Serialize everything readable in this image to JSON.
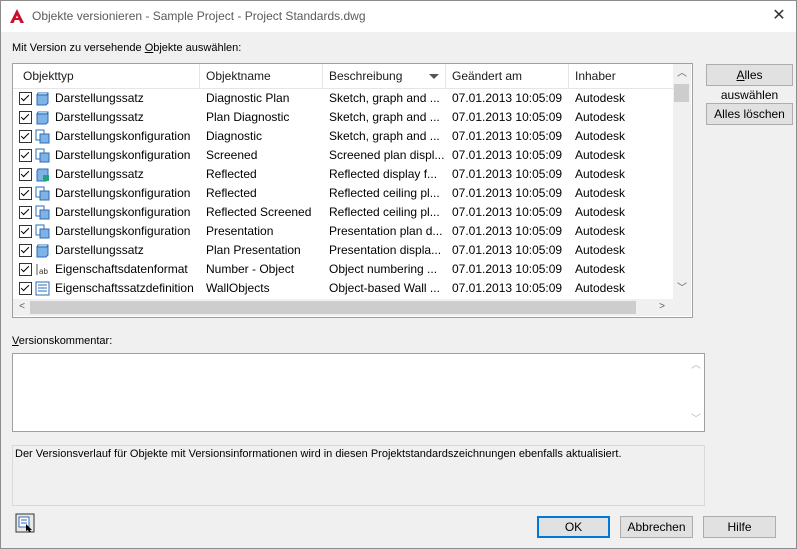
{
  "window": {
    "title": "Objekte versionieren - Sample Project - Project Standards.dwg",
    "close_glyph": "✕"
  },
  "select_label": {
    "before": "Mit Version zu versehende ",
    "underlined": "O",
    "after": "bjekte auswählen:"
  },
  "columns": {
    "type": "Objekttyp",
    "name": "Objektname",
    "description": "Beschreibung",
    "changed": "Geändert am",
    "owner": "Inhaber"
  },
  "rows": [
    {
      "type": "Darstellungssatz",
      "name": "Diagnostic Plan",
      "description": "Sketch, graph and ...",
      "changed": "07.01.2013 10:05:09",
      "owner": "Autodesk",
      "icon": "display-set-icon"
    },
    {
      "type": "Darstellungssatz",
      "name": "Plan Diagnostic",
      "description": "Sketch, graph and ...",
      "changed": "07.01.2013 10:05:09",
      "owner": "Autodesk",
      "icon": "display-set-icon"
    },
    {
      "type": "Darstellungskonfiguration",
      "name": "Diagnostic",
      "description": "Sketch, graph and ...",
      "changed": "07.01.2013 10:05:09",
      "owner": "Autodesk",
      "icon": "display-config-icon"
    },
    {
      "type": "Darstellungskonfiguration",
      "name": "Screened",
      "description": "Screened plan displ...",
      "changed": "07.01.2013 10:05:09",
      "owner": "Autodesk",
      "icon": "display-config-icon"
    },
    {
      "type": "Darstellungssatz",
      "name": "Reflected",
      "description": "Reflected display f...",
      "changed": "07.01.2013 10:05:09",
      "owner": "Autodesk",
      "icon": "display-set-reflected-icon"
    },
    {
      "type": "Darstellungskonfiguration",
      "name": "Reflected",
      "description": "Reflected ceiling pl...",
      "changed": "07.01.2013 10:05:09",
      "owner": "Autodesk",
      "icon": "display-config-icon"
    },
    {
      "type": "Darstellungskonfiguration",
      "name": "Reflected Screened",
      "description": "Reflected ceiling pl...",
      "changed": "07.01.2013 10:05:09",
      "owner": "Autodesk",
      "icon": "display-config-icon"
    },
    {
      "type": "Darstellungskonfiguration",
      "name": "Presentation",
      "description": "Presentation plan d...",
      "changed": "07.01.2013 10:05:09",
      "owner": "Autodesk",
      "icon": "display-config-icon"
    },
    {
      "type": "Darstellungssatz",
      "name": "Plan Presentation",
      "description": "Presentation displa...",
      "changed": "07.01.2013 10:05:09",
      "owner": "Autodesk",
      "icon": "display-set-icon"
    },
    {
      "type": "Eigenschaftsdatenformat",
      "name": "Number - Object",
      "description": "Object numbering ...",
      "changed": "07.01.2013 10:05:09",
      "owner": "Autodesk",
      "icon": "property-format-icon"
    },
    {
      "type": "Eigenschaftssatzdefinition",
      "name": "WallObjects",
      "description": "Object-based Wall ...",
      "changed": "07.01.2013 10:05:09",
      "owner": "Autodesk",
      "icon": "property-set-definition-icon"
    }
  ],
  "buttons": {
    "select_all": {
      "underlined": "A",
      "rest": "lles auswählen"
    },
    "clear_all": "Alles löschen",
    "ok": "OK",
    "cancel": "Abbrechen",
    "help": "Hilfe"
  },
  "comment_label": {
    "underlined": "V",
    "rest": "ersionskommentar:"
  },
  "comment_value": "",
  "info_text": "Der Versionsverlauf für Objekte mit Versionsinformationen wird in diesen Projektstandardszeichnungen ebenfalls aktualisiert.",
  "colors": {
    "accent": "#0078d7",
    "app_red": "#c8102e"
  }
}
